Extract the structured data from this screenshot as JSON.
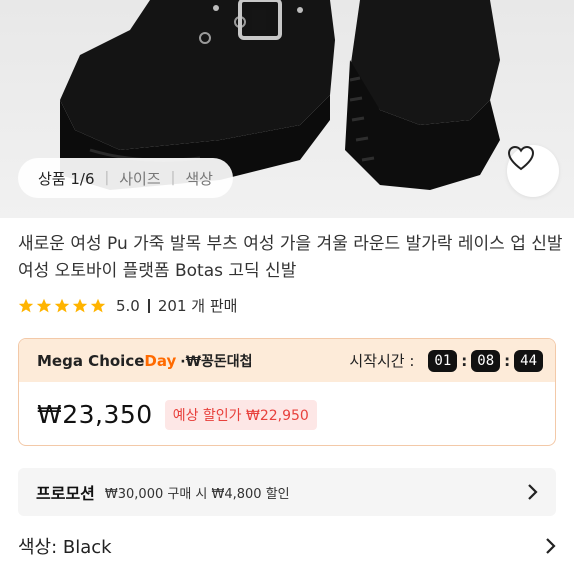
{
  "image_tabs": {
    "product": "상품 1/6",
    "size": "사이즈",
    "color": "색상"
  },
  "product": {
    "title": "새로운 여성 Pu 가죽 발목 부츠 여성 가을 겨울 라운드 발가락 레이스 업 신발 여성 오토바이 플랫폼 Botas 고딕 신발"
  },
  "rating": {
    "score": "5.0",
    "stars": 5,
    "sold": "201 개 판매"
  },
  "promo": {
    "brand_prefix": "Mega Choice",
    "brand_day": "Day",
    "subtitle": "·₩꽁돈대첩",
    "start_label": "시작시간 :",
    "timer": [
      "01",
      "08",
      "44"
    ],
    "price": "₩23,350",
    "expected_discount": "예상 할인가 ₩22,950"
  },
  "promotion": {
    "label": "프로모션",
    "desc": "₩30,000 구매 시 ₩4,800 할인"
  },
  "option": {
    "color_label": "색상: Black"
  },
  "colors": {
    "accent": "#ff6a00",
    "star": "#ffb400",
    "discount_red": "#e8413c",
    "promo_bg": "#fdebd9"
  }
}
